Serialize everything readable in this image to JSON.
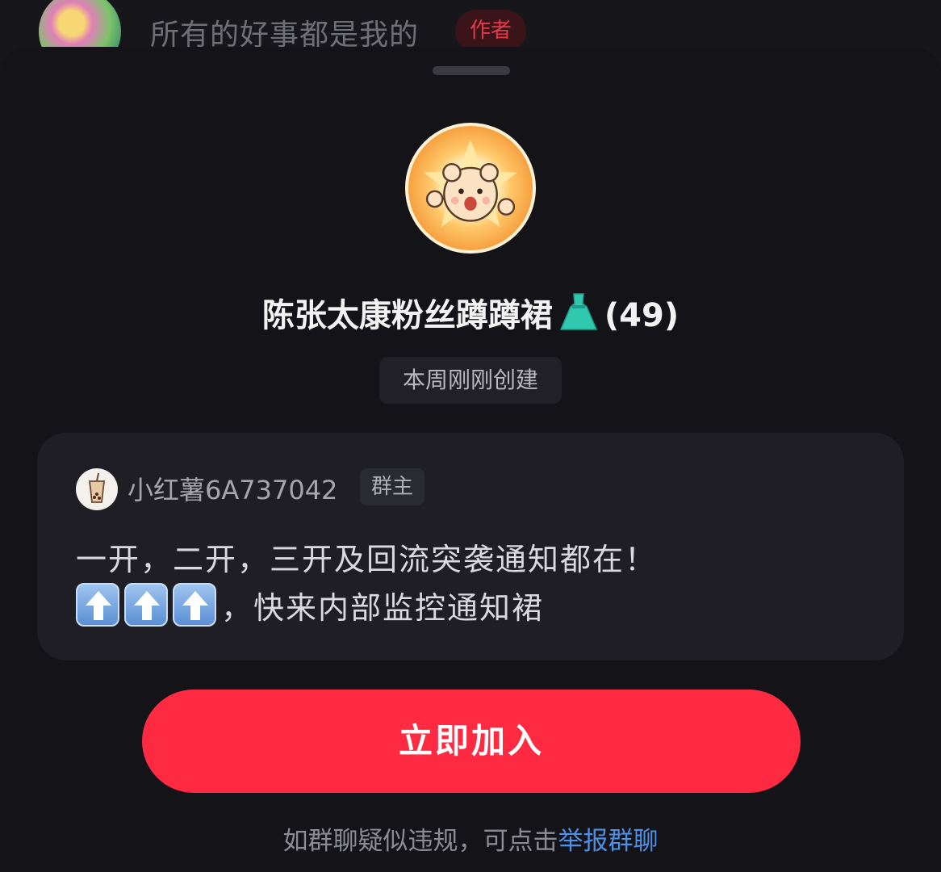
{
  "background_comment": {
    "text": "所有的好事都是我的",
    "badge": "作者"
  },
  "group": {
    "name": "陈张太康粉丝蹲蹲裙",
    "member_count": "(49)",
    "created": "本周刚刚创建"
  },
  "owner": {
    "name": "小红薯6A737042",
    "role": "群主"
  },
  "description": {
    "line1": "一开，二开，三开及回流突袭通知都在！",
    "line2_suffix": "，快来内部监控通知裙"
  },
  "actions": {
    "join_label": "立即加入"
  },
  "footer": {
    "report_prefix": "如群聊疑似违规，可点击",
    "report_link": "举报群聊"
  },
  "colors": {
    "accent": "#fe2a42",
    "link": "#4f8fe6",
    "sheet_bg": "#131318"
  },
  "icons": [
    "dress-icon",
    "up-arrow-icon",
    "bubble-tea-icon"
  ]
}
